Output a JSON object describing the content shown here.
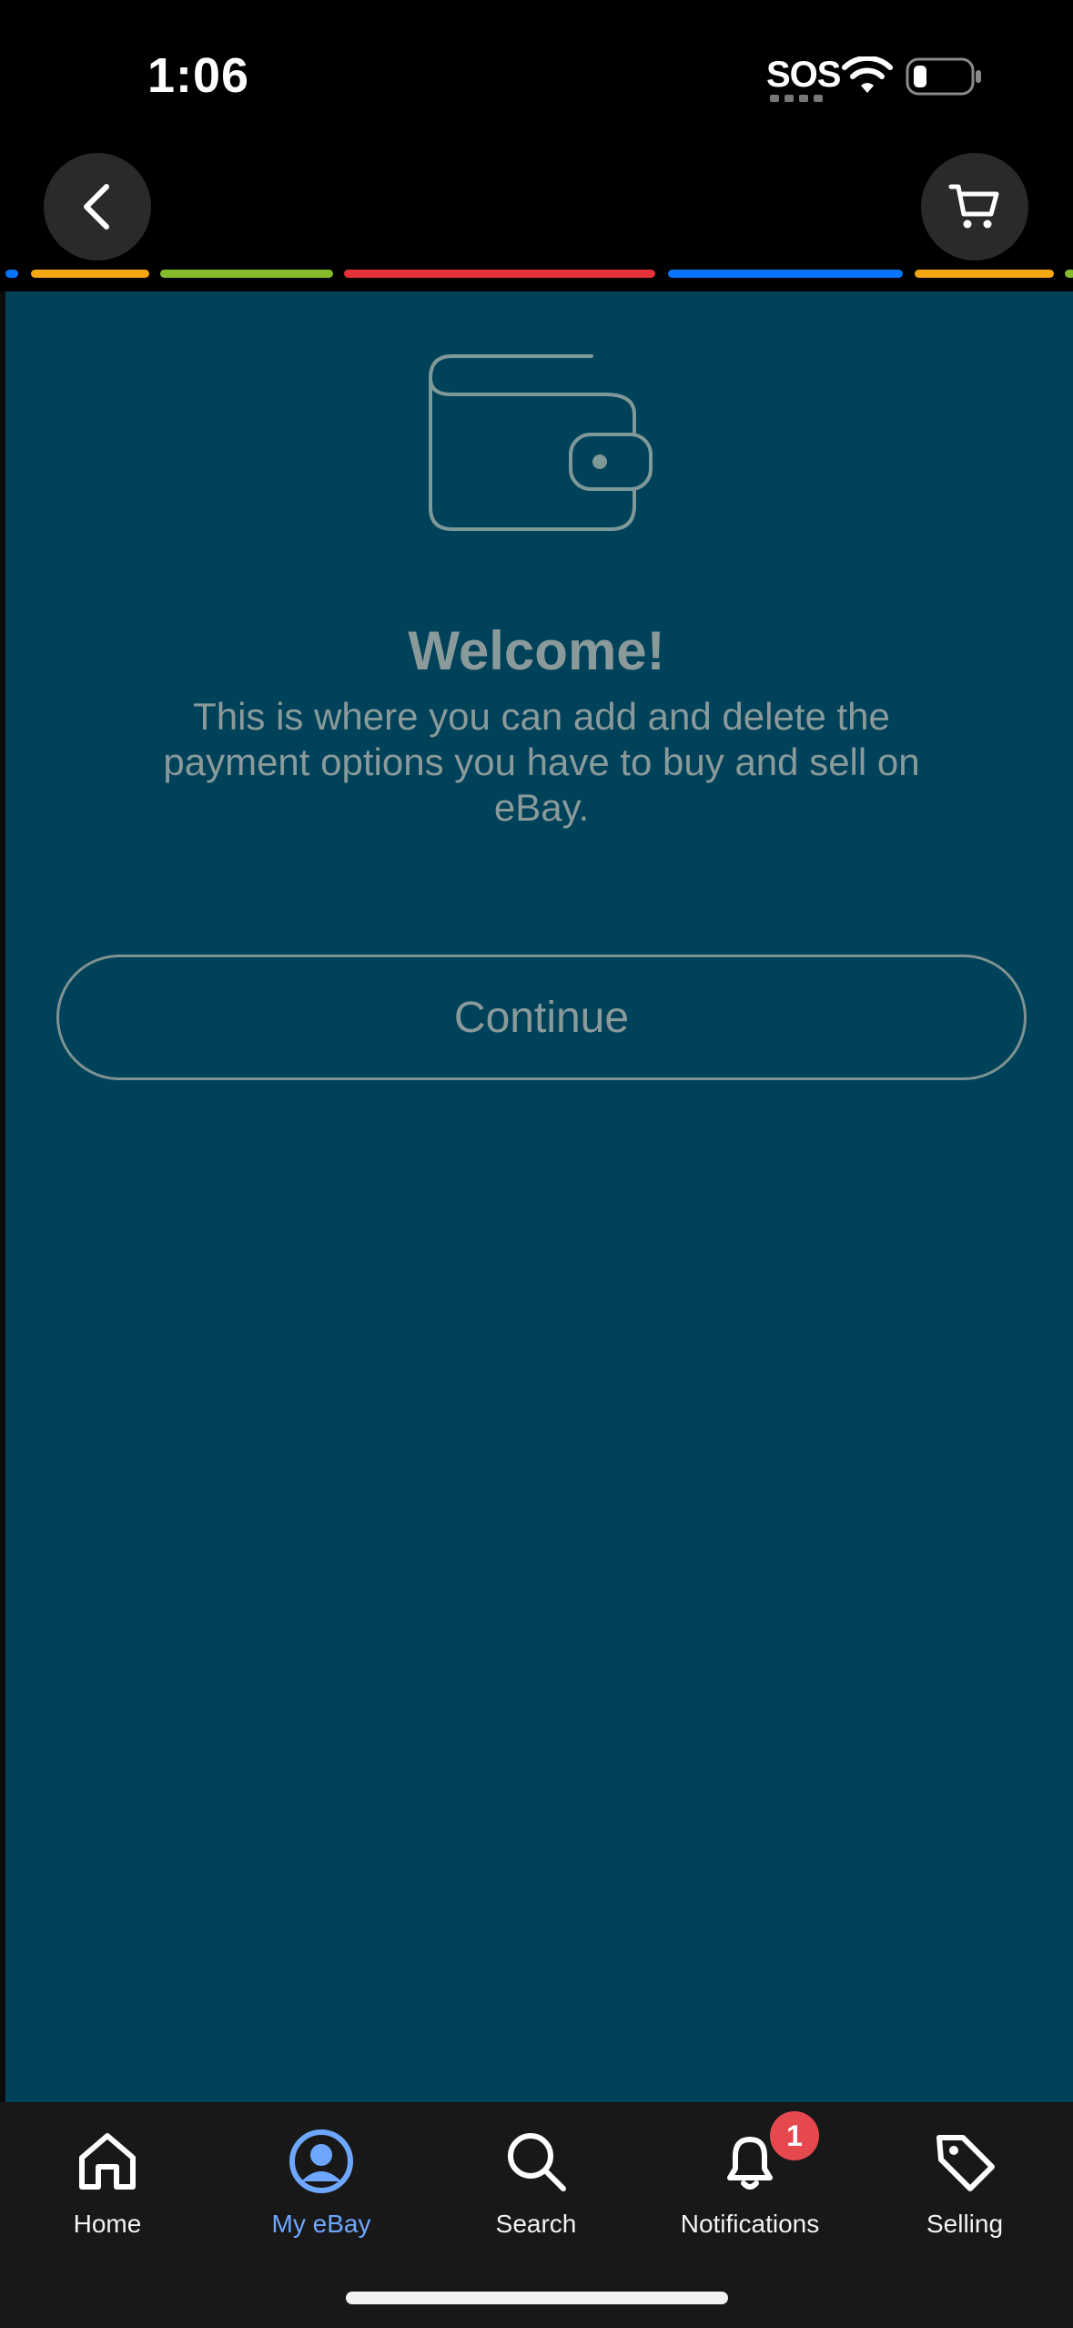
{
  "status_bar": {
    "time": "1:06",
    "sos": "SOS",
    "icons": [
      "wifi-icon",
      "battery-icon"
    ]
  },
  "top_nav": {
    "back_icon": "chevron-left-icon",
    "cart_icon": "cart-icon"
  },
  "stripe_colors": [
    "#0a74ff",
    "#f3a712",
    "#84bb2a",
    "#e53238",
    "#0a74ff",
    "#f3a712",
    "#84bb2a"
  ],
  "panel": {
    "background": "#00425a",
    "icon": "wallet-icon",
    "title": "Welcome!",
    "description": "This is where you can add and delete the payment options you have to buy and sell on eBay.",
    "continue_label": "Continue"
  },
  "tab_bar": {
    "tabs": [
      {
        "label": "Home",
        "icon": "home-icon",
        "active": false
      },
      {
        "label": "My eBay",
        "icon": "user-circle-icon",
        "active": true
      },
      {
        "label": "Search",
        "icon": "search-icon",
        "active": false
      },
      {
        "label": "Notifications",
        "icon": "bell-icon",
        "active": false,
        "badge": "1"
      },
      {
        "label": "Selling",
        "icon": "tag-icon",
        "active": false
      }
    ],
    "active_color": "#6ea7ff"
  }
}
